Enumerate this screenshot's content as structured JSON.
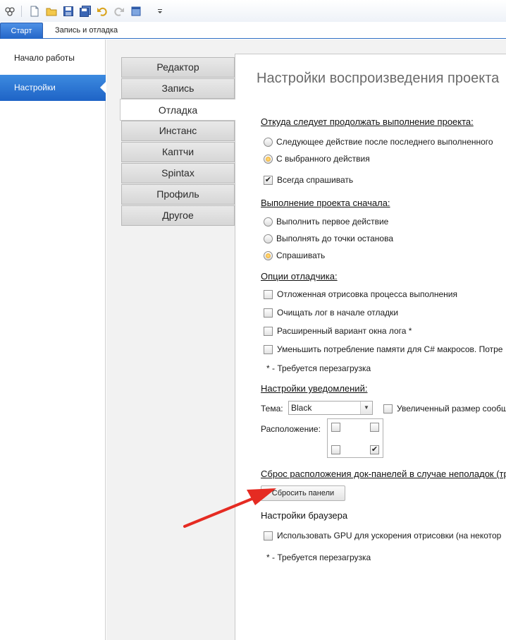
{
  "toolbar": {
    "icons": [
      "logo-icon",
      "new-file-icon",
      "open-folder-icon",
      "save-icon",
      "save-all-icon",
      "undo-icon",
      "redo-icon",
      "window-icon",
      "customize-dropdown-icon"
    ]
  },
  "ribbon": {
    "tabs": [
      {
        "label": "Старт",
        "active": true
      },
      {
        "label": "Запись и отладка",
        "active": false
      }
    ]
  },
  "sidebar": {
    "items": [
      {
        "label": "Начало работы"
      },
      {
        "label": "Настройки",
        "selected": true
      }
    ]
  },
  "settings_tabs": [
    {
      "label": "Редактор"
    },
    {
      "label": "Запись"
    },
    {
      "label": "Отладка",
      "active": true
    },
    {
      "label": "Инстанс"
    },
    {
      "label": "Каптчи"
    },
    {
      "label": "Spintax"
    },
    {
      "label": "Профиль"
    },
    {
      "label": "Другое"
    }
  ],
  "panel": {
    "title": "Настройки воспроизведения проекта",
    "continue_section": {
      "heading": "Откуда следует продолжать выполнение проекта:",
      "options": [
        {
          "label": "Следующее действие после последнего выполненного",
          "selected": false
        },
        {
          "label": "С выбранного действия",
          "selected": true
        }
      ],
      "always_ask": {
        "label": "Всегда спрашивать",
        "checked": true
      }
    },
    "start_section": {
      "heading": "Выполнение проекта сначала:",
      "options": [
        {
          "label": "Выполнить первое действие",
          "selected": false
        },
        {
          "label": "Выполнять до точки останова",
          "selected": false
        },
        {
          "label": "Спрашивать",
          "selected": true
        }
      ]
    },
    "debugger_section": {
      "heading": "Опции отладчика:",
      "options": [
        {
          "label": "Отложенная отрисовка процесса выполнения",
          "checked": false
        },
        {
          "label": "Очищать лог в начале отладки",
          "checked": false
        },
        {
          "label": "Расширенный вариант окна лога *",
          "checked": false
        },
        {
          "label": "Уменьшить потребление памяти для C# макросов. Потре",
          "checked": false
        }
      ],
      "note": "* - Требуется перезагрузка"
    },
    "notify_section": {
      "heading": "Настройки уведомлений:",
      "theme_label": "Тема:",
      "theme_value": "Black",
      "large_size": {
        "label": "Увеличенный размер сообщ",
        "checked": false
      },
      "position_label": "Расположение:",
      "position_grid": [
        false,
        false,
        false,
        true
      ]
    },
    "reset_section": {
      "heading": "Сброс расположения док-панелей в случае неполадок (тре",
      "button_label": "Сбросить панели"
    },
    "browser_section": {
      "heading": "Настройки браузера",
      "gpu": {
        "label": "Использовать GPU для ускорения отрисовки (на некотор",
        "checked": false
      },
      "note": "* - Требуется перезагрузка"
    }
  },
  "colors": {
    "accent": "#2366c8",
    "arrow": "#e52b22"
  }
}
